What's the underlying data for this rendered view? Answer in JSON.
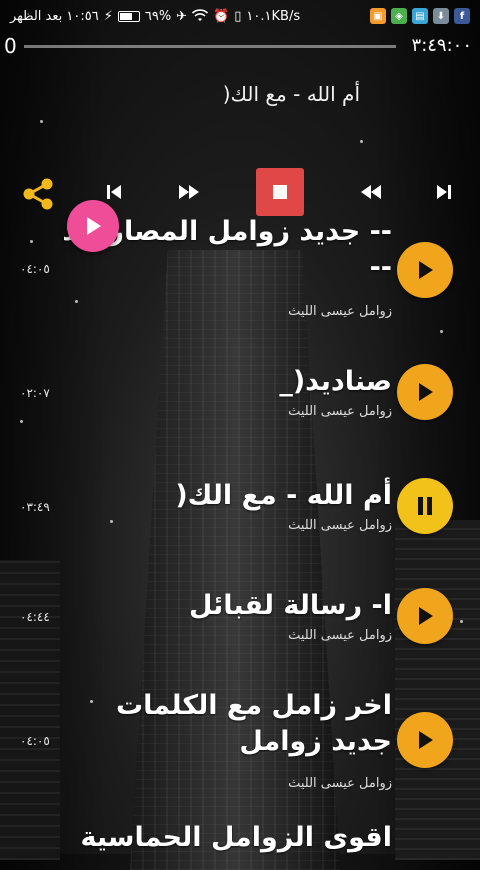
{
  "status_bar": {
    "time": "١٠:٥٦ بعد الظهر",
    "battery": "٦٩%",
    "battery_level": 0.69,
    "speed": "١٠.١KB/s"
  },
  "seek": {
    "position": "0",
    "duration": "٣:٤٩:٠٠"
  },
  "now_playing": {
    "title": "أم الله - مع الك("
  },
  "tracks": [
    {
      "title": "-- جديد زوامل المصارالبد --",
      "artist": "زوامل عيسى الليث",
      "duration": "٠٤:٠٥",
      "state": "play"
    },
    {
      "title": "صناديد(_",
      "artist": "زوامل عيسى الليث",
      "duration": "٠٢:٠٧",
      "state": "play"
    },
    {
      "title": "أم الله - مع الك(",
      "artist": "زوامل عيسى الليث",
      "duration": "٠٣:٤٩",
      "state": "pause"
    },
    {
      "title": "ا- رسالة لقبائل",
      "artist": "زوامل عيسى الليث",
      "duration": "٠٤:٤٤",
      "state": "play"
    },
    {
      "title": "اخر زامل مع الكلمات جديد زوامل",
      "artist": "زوامل عيسى الليث",
      "duration": "٠٤:٠٥",
      "state": "play"
    },
    {
      "title": "اقوى الزوامل الحماسية",
      "artist": "",
      "duration": "",
      "state": "play"
    }
  ],
  "colors": {
    "accent_orange": "#f0a51c",
    "stop_red": "#e04848",
    "fab_pink": "#ef4d97",
    "share_yellow": "#f2b81c"
  }
}
